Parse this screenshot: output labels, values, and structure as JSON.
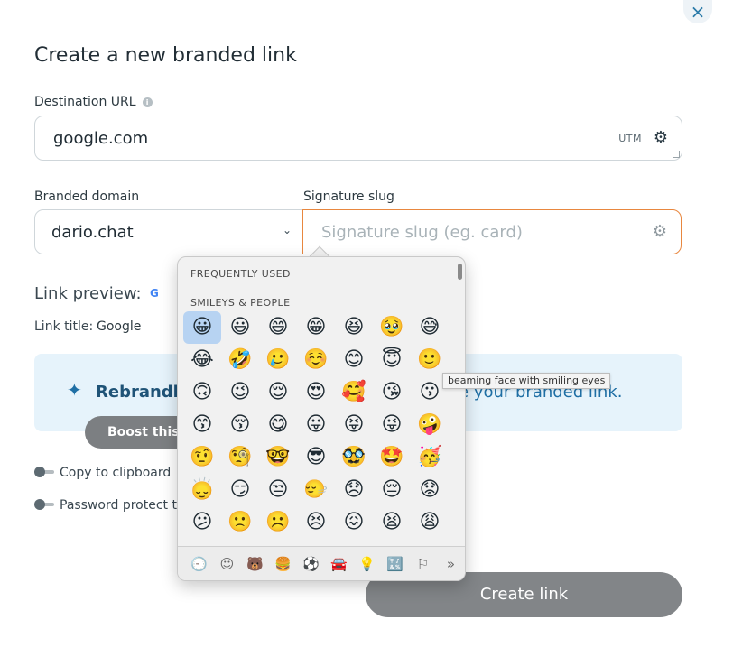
{
  "dialog": {
    "title": "Create a new branded link",
    "close_glyph": "×"
  },
  "destination": {
    "label": "Destination URL",
    "info_glyph": "i",
    "value": "google.com",
    "utm_label": "UTM"
  },
  "domain": {
    "label": "Branded domain",
    "value": "dario.chat"
  },
  "slug": {
    "label": "Signature slug",
    "placeholder": "Signature slug (eg. card)"
  },
  "preview": {
    "label": "Link preview:",
    "favicon": "G",
    "title_label": "Link title:",
    "title_value": "Google"
  },
  "banner": {
    "brand": "Rebrandly",
    "tail": "e your branded link.",
    "boost_label": "Boost this li"
  },
  "toggles": [
    {
      "label": "Copy to clipboard",
      "on": false
    },
    {
      "label": "Password protect th",
      "on": false
    }
  ],
  "create_label": "Create link",
  "emoji_picker": {
    "section_frequent": "FREQUENTLY USED",
    "section_smileys": "SMILEYS & PEOPLE",
    "rows": [
      [
        "😀",
        "😃",
        "😄",
        "😁",
        "😆",
        "🥹",
        "😅"
      ],
      [
        "😂",
        "🤣",
        "🥲",
        "☺️",
        "😊",
        "😇",
        "🙂"
      ],
      [
        "🙃",
        "😉",
        "😌",
        "😍",
        "🥰",
        "😘",
        "😗"
      ],
      [
        "😙",
        "😚",
        "😋",
        "😛",
        "😝",
        "😜",
        "🤪"
      ],
      [
        "🤨",
        "🧐",
        "🤓",
        "😎",
        "🥸",
        "🤩",
        "🥳"
      ],
      [
        "🙂‍↕️",
        "😏",
        "😒",
        "🙂‍↔️",
        "😞",
        "😔",
        "😟"
      ],
      [
        "😕",
        "🙁",
        "☹️",
        "😣",
        "😖",
        "😫",
        "😩"
      ]
    ],
    "tooltip": "beaming face with smiling eyes",
    "categories": [
      "🕘",
      "☺",
      "🐻",
      "🍔",
      "⚽",
      "🚘",
      "💡",
      "🔣",
      "⚐",
      "»"
    ]
  },
  "colors": {
    "accent_orange": "#e8873f",
    "banner_bg": "#e6f3fb",
    "brand_blue": "#1f5377",
    "button_gray": "#828588"
  }
}
